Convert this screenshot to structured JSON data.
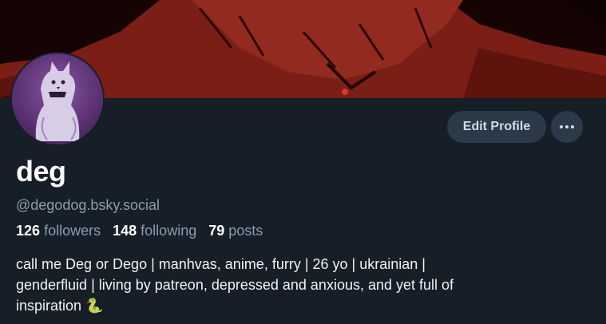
{
  "profile": {
    "display_name": "deg",
    "handle": "@degodog.bsky.social",
    "followers_count": "126",
    "followers_label": "followers",
    "following_count": "148",
    "following_label": "following",
    "posts_count": "79",
    "posts_label": "posts",
    "bio_line1": "call me Deg or Dego | manhvas, anime, furry | 26 yo | ukrainian |",
    "bio_line2": "genderfluid | living by patreon, depressed and anxious, and yet full of",
    "bio_line3": "inspiration",
    "bio_emoji": "🐍"
  },
  "actions": {
    "edit_label": "Edit Profile",
    "more_label": "more-options"
  },
  "colors": {
    "background": "#161e27",
    "button_bg": "#2b3949",
    "muted_text": "#8c9db0",
    "banner_red": "#7a1e16"
  },
  "icons": {
    "banner": "artwork-banner",
    "avatar": "wolf-avatar",
    "more": "ellipsis-icon",
    "emoji": "snake-emoji"
  }
}
